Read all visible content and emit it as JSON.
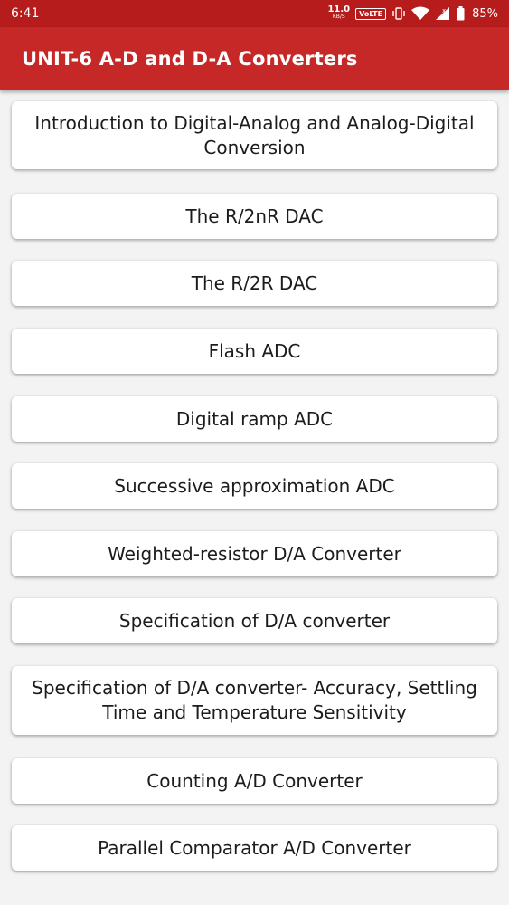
{
  "status_bar": {
    "time": "6:41",
    "net_speed_value": "11.0",
    "net_speed_unit": "KB/S",
    "volte_label": "VoLTE",
    "battery_percent": "85%",
    "icons": [
      "vibrate-icon",
      "wifi-icon",
      "signal-icon",
      "battery-icon"
    ]
  },
  "app_bar": {
    "title": "UNIT-6 A-D and D-A Converters",
    "color": "#c62828"
  },
  "topics": [
    "Introduction to Digital-Analog and Analog-Digital Conversion",
    "The R/2nR DAC",
    "The R/2R DAC",
    "Flash ADC",
    "Digital ramp ADC",
    "Successive approximation ADC",
    "Weighted-resistor D/A Converter",
    "Specification of D/A converter",
    "Specification of D/A converter- Accuracy, Settling Time and Temperature Sensitivity",
    "Counting A/D Converter",
    "Parallel Comparator A/D Converter"
  ]
}
